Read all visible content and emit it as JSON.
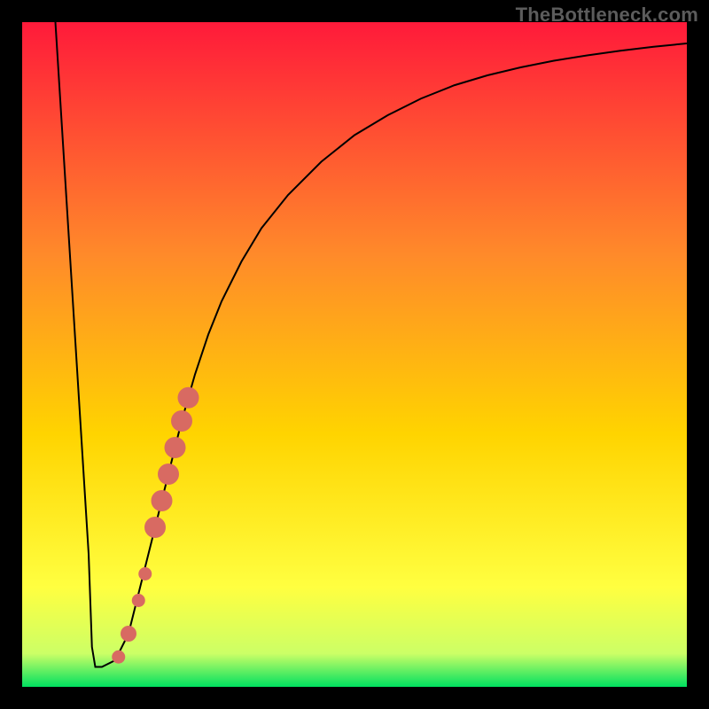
{
  "attribution": "TheBottleneck.com",
  "colors": {
    "frame": "#000000",
    "gradient_top": "#ff1a3a",
    "gradient_mid1": "#ff6a2a",
    "gradient_mid2": "#ffd400",
    "gradient_mid3": "#ffff40",
    "gradient_bottom": "#00e060",
    "curve": "#000000",
    "marker": "#d86a62"
  },
  "chart_data": {
    "type": "line",
    "title": "",
    "xlabel": "",
    "ylabel": "",
    "xlim": [
      0,
      100
    ],
    "ylim": [
      0,
      100
    ],
    "series": [
      {
        "name": "bottleneck-curve",
        "x": [
          5,
          6,
          7,
          8,
          9,
          10,
          10.5,
          11,
          12,
          14,
          16,
          18,
          20,
          22,
          24,
          26,
          28,
          30,
          33,
          36,
          40,
          45,
          50,
          55,
          60,
          65,
          70,
          75,
          80,
          85,
          90,
          95,
          100
        ],
        "y": [
          100,
          84,
          68,
          52,
          36,
          20,
          6,
          3,
          3,
          4,
          8,
          16,
          24,
          32,
          40,
          47,
          53,
          58,
          64,
          69,
          74,
          79,
          83,
          86,
          88.5,
          90.5,
          92,
          93.2,
          94.2,
          95,
          95.7,
          96.3,
          96.8
        ]
      }
    ],
    "markers": {
      "name": "highlighted-points",
      "color": "#d86a62",
      "points": [
        {
          "x": 14.5,
          "y": 4.5,
          "r": 1.0
        },
        {
          "x": 16.0,
          "y": 8.0,
          "r": 1.2
        },
        {
          "x": 17.5,
          "y": 13.0,
          "r": 1.0
        },
        {
          "x": 18.5,
          "y": 17.0,
          "r": 1.0
        },
        {
          "x": 20.0,
          "y": 24.0,
          "r": 1.6
        },
        {
          "x": 21.0,
          "y": 28.0,
          "r": 1.6
        },
        {
          "x": 22.0,
          "y": 32.0,
          "r": 1.6
        },
        {
          "x": 23.0,
          "y": 36.0,
          "r": 1.6
        },
        {
          "x": 24.0,
          "y": 40.0,
          "r": 1.6
        },
        {
          "x": 25.0,
          "y": 43.5,
          "r": 1.6
        }
      ]
    }
  }
}
